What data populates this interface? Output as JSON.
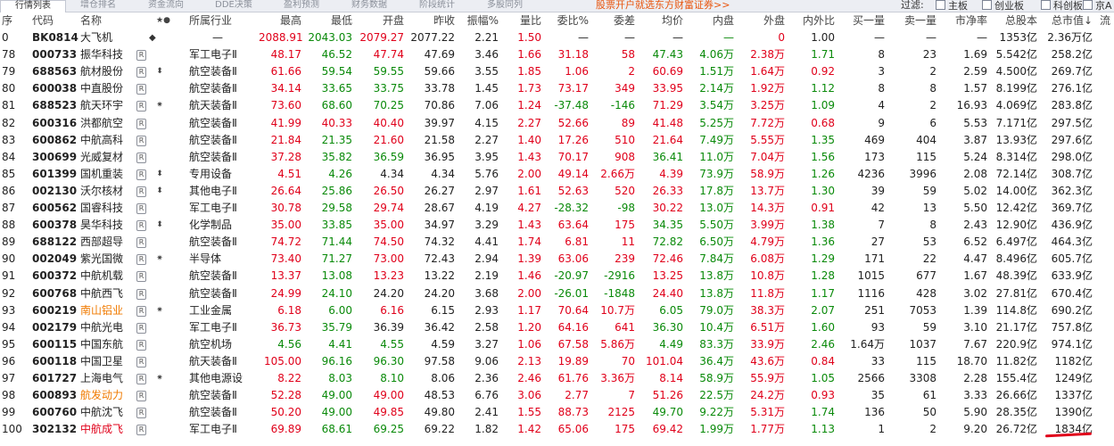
{
  "tabs": [
    "行情列表",
    "增仓排名",
    "资金流向",
    "DDE决策",
    "盈利预测",
    "财务数据",
    "阶段统计",
    "多股同列"
  ],
  "promo": "股票开户就选东方财富证券>>",
  "filters": {
    "label": "过滤:",
    "options": [
      "主板",
      "创业板",
      "科创板",
      "京A"
    ]
  },
  "columns": [
    "序",
    "代码",
    "名称",
    "★●",
    "所属行业",
    "最高",
    "最低",
    "开盘",
    "昨收",
    "振幅%",
    "量比",
    "委比%",
    "委差",
    "均价",
    "内盘",
    "外盘",
    "内外比",
    "买一量",
    "卖一量",
    "市净率",
    "总股本",
    "总市值↓",
    "流"
  ],
  "rows": [
    {
      "seq": "0",
      "code": "BK0814",
      "name": "大飞机",
      "nc": "n",
      "r": false,
      "mk": "◆",
      "ind": "—",
      "high": "2088.91",
      "hc": "red",
      "low": "2043.03",
      "lc": "grn",
      "open": "2079.27",
      "oc": "red",
      "prev": "2077.22",
      "amp": "2.21",
      "vr": "1.50",
      "wb": "—",
      "wbc": "bc",
      "wc": "—",
      "wcc": "bc",
      "avg": "—",
      "ac": "bc",
      "inv": "—",
      "outv": "0",
      "ior": "1.00",
      "iorc": "bc",
      "b1": "—",
      "s1": "—",
      "pb": "—",
      "tshare": "1353亿",
      "mcap": "2.36万亿"
    },
    {
      "seq": "78",
      "code": "000733",
      "name": "振华科技",
      "nc": "n",
      "r": true,
      "mk": "",
      "ind": "军工电子Ⅱ",
      "high": "48.17",
      "hc": "red",
      "low": "46.52",
      "lc": "grn",
      "open": "47.74",
      "oc": "red",
      "prev": "47.69",
      "amp": "3.46",
      "vr": "1.66",
      "wb": "31.18",
      "wbc": "red",
      "wc": "58",
      "wcc": "red",
      "avg": "47.43",
      "ac": "grn",
      "inv": "4.06万",
      "outv": "2.38万",
      "ior": "1.71",
      "iorc": "grn",
      "b1": "8",
      "s1": "23",
      "pb": "1.69",
      "tshare": "5.542亿",
      "mcap": "258.2亿"
    },
    {
      "seq": "79",
      "code": "688563",
      "name": "航材股份",
      "nc": "n",
      "r": true,
      "mk": "⬍",
      "ind": "航空装备Ⅱ",
      "high": "61.66",
      "hc": "red",
      "low": "59.54",
      "lc": "grn",
      "open": "59.55",
      "oc": "grn",
      "prev": "59.66",
      "amp": "3.55",
      "vr": "1.85",
      "wb": "1.06",
      "wbc": "red",
      "wc": "2",
      "wcc": "red",
      "avg": "60.69",
      "ac": "red",
      "inv": "1.51万",
      "outv": "1.64万",
      "ior": "0.92",
      "iorc": "red",
      "b1": "3",
      "s1": "2",
      "pb": "2.59",
      "tshare": "4.500亿",
      "mcap": "269.7亿"
    },
    {
      "seq": "80",
      "code": "600038",
      "name": "中直股份",
      "nc": "n",
      "r": true,
      "mk": "",
      "ind": "航空装备Ⅱ",
      "high": "34.14",
      "hc": "red",
      "low": "33.65",
      "lc": "grn",
      "open": "33.75",
      "oc": "grn",
      "prev": "33.78",
      "amp": "1.45",
      "vr": "1.73",
      "wb": "73.17",
      "wbc": "red",
      "wc": "349",
      "wcc": "red",
      "avg": "33.95",
      "ac": "red",
      "inv": "2.14万",
      "outv": "1.92万",
      "ior": "1.12",
      "iorc": "grn",
      "b1": "8",
      "s1": "8",
      "pb": "1.57",
      "tshare": "8.199亿",
      "mcap": "276.1亿"
    },
    {
      "seq": "81",
      "code": "688523",
      "name": "航天环宇",
      "nc": "n",
      "r": true,
      "mk": "✷",
      "ind": "航天装备Ⅱ",
      "high": "73.60",
      "hc": "red",
      "low": "68.60",
      "lc": "grn",
      "open": "70.25",
      "oc": "grn",
      "prev": "70.86",
      "amp": "7.06",
      "vr": "1.24",
      "wb": "-37.48",
      "wbc": "grn",
      "wc": "-146",
      "wcc": "grn",
      "avg": "71.29",
      "ac": "red",
      "inv": "3.54万",
      "outv": "3.25万",
      "ior": "1.09",
      "iorc": "grn",
      "b1": "4",
      "s1": "2",
      "pb": "16.93",
      "tshare": "4.069亿",
      "mcap": "283.8亿"
    },
    {
      "seq": "82",
      "code": "600316",
      "name": "洪都航空",
      "nc": "n",
      "r": true,
      "mk": "",
      "ind": "航空装备Ⅱ",
      "high": "41.99",
      "hc": "red",
      "low": "40.33",
      "lc": "red",
      "open": "40.40",
      "oc": "red",
      "prev": "39.97",
      "amp": "4.15",
      "vr": "2.27",
      "wb": "52.66",
      "wbc": "red",
      "wc": "89",
      "wcc": "red",
      "avg": "41.48",
      "ac": "red",
      "inv": "5.25万",
      "outv": "7.72万",
      "ior": "0.68",
      "iorc": "red",
      "b1": "9",
      "s1": "6",
      "pb": "5.53",
      "tshare": "7.171亿",
      "mcap": "297.5亿"
    },
    {
      "seq": "83",
      "code": "600862",
      "name": "中航高科",
      "nc": "n",
      "r": true,
      "mk": "",
      "ind": "航空装备Ⅱ",
      "high": "21.84",
      "hc": "red",
      "low": "21.35",
      "lc": "grn",
      "open": "21.60",
      "oc": "red",
      "prev": "21.58",
      "amp": "2.27",
      "vr": "1.40",
      "wb": "17.26",
      "wbc": "red",
      "wc": "510",
      "wcc": "red",
      "avg": "21.64",
      "ac": "red",
      "inv": "7.49万",
      "outv": "5.55万",
      "ior": "1.35",
      "iorc": "grn",
      "b1": "469",
      "s1": "404",
      "pb": "3.87",
      "tshare": "13.93亿",
      "mcap": "297.6亿"
    },
    {
      "seq": "84",
      "code": "300699",
      "name": "光威复材",
      "nc": "n",
      "r": true,
      "mk": "",
      "ind": "航空装备Ⅱ",
      "high": "37.28",
      "hc": "red",
      "low": "35.82",
      "lc": "grn",
      "open": "36.59",
      "oc": "grn",
      "prev": "36.95",
      "amp": "3.95",
      "vr": "1.43",
      "wb": "70.17",
      "wbc": "red",
      "wc": "908",
      "wcc": "red",
      "avg": "36.41",
      "ac": "grn",
      "inv": "11.0万",
      "outv": "7.04万",
      "ior": "1.56",
      "iorc": "grn",
      "b1": "173",
      "s1": "115",
      "pb": "5.24",
      "tshare": "8.314亿",
      "mcap": "298.0亿"
    },
    {
      "seq": "85",
      "code": "601399",
      "name": "国机重装",
      "nc": "n",
      "r": true,
      "mk": "⬍",
      "ind": "专用设备",
      "high": "4.51",
      "hc": "red",
      "low": "4.26",
      "lc": "grn",
      "open": "4.34",
      "oc": "bc",
      "prev": "4.34",
      "amp": "5.76",
      "vr": "2.00",
      "wb": "49.14",
      "wbc": "red",
      "wc": "2.66万",
      "wcc": "red",
      "avg": "4.39",
      "ac": "red",
      "inv": "73.9万",
      "outv": "58.9万",
      "ior": "1.26",
      "iorc": "grn",
      "b1": "4236",
      "s1": "3996",
      "pb": "2.08",
      "tshare": "72.14亿",
      "mcap": "308.7亿"
    },
    {
      "seq": "86",
      "code": "002130",
      "name": "沃尔核材",
      "nc": "n",
      "r": true,
      "mk": "⬍",
      "ind": "其他电子Ⅱ",
      "high": "26.64",
      "hc": "red",
      "low": "25.86",
      "lc": "grn",
      "open": "26.50",
      "oc": "red",
      "prev": "26.27",
      "amp": "2.97",
      "vr": "1.61",
      "wb": "52.63",
      "wbc": "red",
      "wc": "520",
      "wcc": "red",
      "avg": "26.33",
      "ac": "red",
      "inv": "17.8万",
      "outv": "13.7万",
      "ior": "1.30",
      "iorc": "grn",
      "b1": "39",
      "s1": "59",
      "pb": "5.02",
      "tshare": "14.00亿",
      "mcap": "362.3亿"
    },
    {
      "seq": "87",
      "code": "600562",
      "name": "国睿科技",
      "nc": "n",
      "r": true,
      "mk": "",
      "ind": "军工电子Ⅱ",
      "high": "30.78",
      "hc": "red",
      "low": "29.58",
      "lc": "grn",
      "open": "29.74",
      "oc": "red",
      "prev": "28.67",
      "amp": "4.19",
      "vr": "4.27",
      "wb": "-28.32",
      "wbc": "grn",
      "wc": "-98",
      "wcc": "grn",
      "avg": "30.22",
      "ac": "red",
      "inv": "13.0万",
      "outv": "14.3万",
      "ior": "0.91",
      "iorc": "red",
      "b1": "42",
      "s1": "13",
      "pb": "5.50",
      "tshare": "12.42亿",
      "mcap": "369.7亿"
    },
    {
      "seq": "88",
      "code": "600378",
      "name": "昊华科技",
      "nc": "n",
      "r": true,
      "mk": "⬍",
      "ind": "化学制品",
      "high": "35.00",
      "hc": "red",
      "low": "33.85",
      "lc": "grn",
      "open": "35.00",
      "oc": "red",
      "prev": "34.97",
      "amp": "3.29",
      "vr": "1.43",
      "wb": "63.64",
      "wbc": "red",
      "wc": "175",
      "wcc": "red",
      "avg": "34.35",
      "ac": "grn",
      "inv": "5.50万",
      "outv": "3.99万",
      "ior": "1.38",
      "iorc": "grn",
      "b1": "7",
      "s1": "8",
      "pb": "2.43",
      "tshare": "12.90亿",
      "mcap": "436.9亿"
    },
    {
      "seq": "89",
      "code": "688122",
      "name": "西部超导",
      "nc": "n",
      "r": true,
      "mk": "",
      "ind": "航空装备Ⅱ",
      "high": "74.72",
      "hc": "red",
      "low": "71.44",
      "lc": "grn",
      "open": "74.50",
      "oc": "red",
      "prev": "74.32",
      "amp": "4.41",
      "vr": "1.74",
      "wb": "6.81",
      "wbc": "red",
      "wc": "11",
      "wcc": "red",
      "avg": "72.82",
      "ac": "grn",
      "inv": "6.50万",
      "outv": "4.79万",
      "ior": "1.36",
      "iorc": "grn",
      "b1": "27",
      "s1": "53",
      "pb": "6.52",
      "tshare": "6.497亿",
      "mcap": "464.3亿"
    },
    {
      "seq": "90",
      "code": "002049",
      "name": "紫光国微",
      "nc": "n",
      "r": true,
      "mk": "✷",
      "ind": "半导体",
      "high": "73.40",
      "hc": "red",
      "low": "71.27",
      "lc": "grn",
      "open": "73.00",
      "oc": "red",
      "prev": "72.43",
      "amp": "2.94",
      "vr": "1.39",
      "wb": "63.06",
      "wbc": "red",
      "wc": "239",
      "wcc": "red",
      "avg": "72.46",
      "ac": "red",
      "inv": "7.84万",
      "outv": "6.08万",
      "ior": "1.29",
      "iorc": "grn",
      "b1": "171",
      "s1": "22",
      "pb": "4.47",
      "tshare": "8.496亿",
      "mcap": "605.7亿"
    },
    {
      "seq": "91",
      "code": "600372",
      "name": "中航机载",
      "nc": "n",
      "r": true,
      "mk": "",
      "ind": "航空装备Ⅱ",
      "high": "13.37",
      "hc": "red",
      "low": "13.08",
      "lc": "grn",
      "open": "13.23",
      "oc": "red",
      "prev": "13.22",
      "amp": "2.19",
      "vr": "1.46",
      "wb": "-20.97",
      "wbc": "grn",
      "wc": "-2916",
      "wcc": "grn",
      "avg": "13.25",
      "ac": "red",
      "inv": "13.8万",
      "outv": "10.8万",
      "ior": "1.28",
      "iorc": "grn",
      "b1": "1015",
      "s1": "677",
      "pb": "1.67",
      "tshare": "48.39亿",
      "mcap": "633.9亿"
    },
    {
      "seq": "92",
      "code": "600768",
      "name": "中航西飞",
      "nc": "n",
      "r": true,
      "mk": "",
      "ind": "航空装备Ⅱ",
      "high": "24.99",
      "hc": "red",
      "low": "24.10",
      "lc": "grn",
      "open": "24.20",
      "oc": "bc",
      "prev": "24.20",
      "amp": "3.68",
      "vr": "2.00",
      "wb": "-26.01",
      "wbc": "grn",
      "wc": "-1848",
      "wcc": "grn",
      "avg": "24.40",
      "ac": "red",
      "inv": "13.8万",
      "outv": "11.8万",
      "ior": "1.17",
      "iorc": "grn",
      "b1": "1116",
      "s1": "428",
      "pb": "3.02",
      "tshare": "27.81亿",
      "mcap": "670.4亿"
    },
    {
      "seq": "93",
      "code": "600219",
      "name": "南山铝业",
      "nc": "o",
      "r": true,
      "mk": "✷",
      "ind": "工业金属",
      "high": "6.18",
      "hc": "red",
      "low": "6.00",
      "lc": "grn",
      "open": "6.16",
      "oc": "red",
      "prev": "6.15",
      "amp": "2.93",
      "vr": "1.17",
      "wb": "70.64",
      "wbc": "red",
      "wc": "10.7万",
      "wcc": "red",
      "avg": "6.05",
      "ac": "grn",
      "inv": "79.0万",
      "outv": "38.3万",
      "ior": "2.07",
      "iorc": "grn",
      "b1": "251",
      "s1": "7053",
      "pb": "1.39",
      "tshare": "114.8亿",
      "mcap": "690.2亿"
    },
    {
      "seq": "94",
      "code": "002179",
      "name": "中航光电",
      "nc": "n",
      "r": true,
      "mk": "",
      "ind": "军工电子Ⅱ",
      "high": "36.73",
      "hc": "red",
      "low": "35.79",
      "lc": "grn",
      "open": "36.39",
      "oc": "bc",
      "prev": "36.42",
      "amp": "2.58",
      "vr": "1.20",
      "wb": "64.16",
      "wbc": "red",
      "wc": "641",
      "wcc": "red",
      "avg": "36.30",
      "ac": "grn",
      "inv": "10.4万",
      "outv": "6.51万",
      "ior": "1.60",
      "iorc": "grn",
      "b1": "93",
      "s1": "59",
      "pb": "3.10",
      "tshare": "21.17亿",
      "mcap": "757.8亿"
    },
    {
      "seq": "95",
      "code": "600115",
      "name": "中国东航",
      "nc": "n",
      "r": true,
      "mk": "",
      "ind": "航空机场",
      "high": "4.56",
      "hc": "grn",
      "low": "4.41",
      "lc": "grn",
      "open": "4.55",
      "oc": "grn",
      "prev": "4.59",
      "amp": "3.27",
      "vr": "1.06",
      "wb": "67.58",
      "wbc": "red",
      "wc": "5.86万",
      "wcc": "red",
      "avg": "4.49",
      "ac": "grn",
      "inv": "83.3万",
      "outv": "33.9万",
      "ior": "2.46",
      "iorc": "grn",
      "b1": "1.64万",
      "s1": "1037",
      "pb": "7.67",
      "tshare": "220.9亿",
      "mcap": "974.1亿"
    },
    {
      "seq": "96",
      "code": "600118",
      "name": "中国卫星",
      "nc": "n",
      "r": true,
      "mk": "",
      "ind": "航天装备Ⅱ",
      "high": "105.00",
      "hc": "red",
      "low": "96.16",
      "lc": "grn",
      "open": "96.30",
      "oc": "grn",
      "prev": "97.58",
      "amp": "9.06",
      "vr": "2.13",
      "wb": "19.89",
      "wbc": "red",
      "wc": "70",
      "wcc": "red",
      "avg": "101.04",
      "ac": "red",
      "inv": "36.4万",
      "outv": "43.6万",
      "ior": "0.84",
      "iorc": "red",
      "b1": "33",
      "s1": "115",
      "pb": "18.70",
      "tshare": "11.82亿",
      "mcap": "1182亿"
    },
    {
      "seq": "97",
      "code": "601727",
      "name": "上海电气",
      "nc": "n",
      "r": true,
      "mk": "✷",
      "ind": "其他电源设",
      "high": "8.22",
      "hc": "red",
      "low": "8.03",
      "lc": "grn",
      "open": "8.10",
      "oc": "grn",
      "prev": "8.06",
      "amp": "2.36",
      "vr": "2.46",
      "wb": "61.76",
      "wbc": "red",
      "wc": "3.36万",
      "wcc": "red",
      "avg": "8.14",
      "ac": "red",
      "inv": "58.9万",
      "outv": "55.9万",
      "ior": "1.05",
      "iorc": "grn",
      "b1": "2566",
      "s1": "3308",
      "pb": "2.28",
      "tshare": "155.4亿",
      "mcap": "1249亿"
    },
    {
      "seq": "98",
      "code": "600893",
      "name": "航发动力",
      "nc": "o",
      "r": true,
      "mk": "",
      "ind": "航空装备Ⅱ",
      "high": "52.28",
      "hc": "red",
      "low": "49.00",
      "lc": "grn",
      "open": "49.00",
      "oc": "red",
      "prev": "48.53",
      "amp": "6.76",
      "vr": "3.06",
      "wb": "2.77",
      "wbc": "red",
      "wc": "7",
      "wcc": "red",
      "avg": "51.26",
      "ac": "red",
      "inv": "22.5万",
      "outv": "24.2万",
      "ior": "0.93",
      "iorc": "red",
      "b1": "35",
      "s1": "61",
      "pb": "3.33",
      "tshare": "26.66亿",
      "mcap": "1337亿"
    },
    {
      "seq": "99",
      "code": "600760",
      "name": "中航沈飞",
      "nc": "n",
      "r": true,
      "mk": "",
      "ind": "航空装备Ⅱ",
      "high": "50.20",
      "hc": "red",
      "low": "49.00",
      "lc": "grn",
      "open": "49.85",
      "oc": "red",
      "prev": "49.80",
      "amp": "2.41",
      "vr": "1.55",
      "wb": "88.73",
      "wbc": "red",
      "wc": "2125",
      "wcc": "red",
      "avg": "49.70",
      "ac": "grn",
      "inv": "9.22万",
      "outv": "5.31万",
      "ior": "1.74",
      "iorc": "grn",
      "b1": "136",
      "s1": "50",
      "pb": "5.90",
      "tshare": "28.35亿",
      "mcap": "1390亿"
    },
    {
      "seq": "100",
      "code": "302132",
      "name": "中航成飞",
      "nc": "r",
      "r": true,
      "mk": "",
      "ind": "军工电子Ⅱ",
      "high": "69.89",
      "hc": "red",
      "low": "68.61",
      "lc": "grn",
      "open": "69.25",
      "oc": "grn",
      "prev": "69.22",
      "amp": "1.82",
      "vr": "1.42",
      "wb": "65.06",
      "wbc": "red",
      "wc": "175",
      "wcc": "red",
      "avg": "69.42",
      "ac": "red",
      "inv": "1.99万",
      "outv": "1.77万",
      "ior": "1.13",
      "iorc": "grn",
      "b1": "1",
      "s1": "2",
      "pb": "9.20",
      "tshare": "26.72亿",
      "mcap": "1834亿"
    }
  ]
}
